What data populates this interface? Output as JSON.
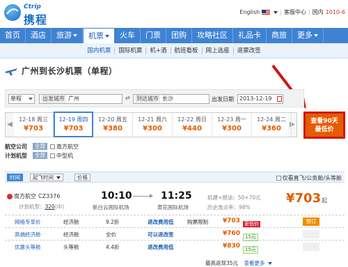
{
  "brand": {
    "logo_en": "Ctrip",
    "logo_cn": "携程"
  },
  "topbar": {
    "language": "English",
    "service": "客服中心",
    "intl": "国内",
    "phone": "1010-6"
  },
  "nav": {
    "items": [
      {
        "label": "首页",
        "active": false,
        "caret": false
      },
      {
        "label": "酒店",
        "active": false,
        "caret": false
      },
      {
        "label": "旅游",
        "active": false,
        "caret": true
      },
      {
        "label": "机票",
        "active": true,
        "caret": true
      },
      {
        "label": "火车",
        "active": false,
        "caret": false
      },
      {
        "label": "门票",
        "active": false,
        "caret": false
      },
      {
        "label": "团购",
        "active": false,
        "caret": false
      },
      {
        "label": "攻略社区",
        "active": false,
        "caret": false
      },
      {
        "label": "礼品卡",
        "active": false,
        "caret": false
      },
      {
        "label": "商旅",
        "active": false,
        "caret": false
      },
      {
        "label": "更多",
        "active": false,
        "caret": true
      }
    ]
  },
  "subnav": {
    "items": [
      {
        "label": "国内机票",
        "active": true
      },
      {
        "label": "国际机票",
        "active": false
      },
      {
        "label": "机+酒",
        "active": false
      },
      {
        "label": "航班看板",
        "active": false
      },
      {
        "label": "网上选座",
        "active": false
      },
      {
        "label": "退票改签",
        "active": false
      }
    ]
  },
  "title": "广州到长沙机票（单程）",
  "search": {
    "trip_type": "单程",
    "from_label": "出发城市",
    "from_value": "广州",
    "to_label": "到达城市",
    "to_value": "长沙",
    "date_label": "出发日期",
    "date_value": "2013-12-19"
  },
  "dates": [
    {
      "date": "12-18 周三",
      "price": "¥703",
      "active": false
    },
    {
      "date": "12-19 周四",
      "price": "¥703",
      "active": true
    },
    {
      "date": "12-20 周五",
      "price": "¥380",
      "active": false
    },
    {
      "date": "12-21 周六",
      "price": "¥300",
      "active": false
    },
    {
      "date": "12-22 周日",
      "price": "¥440",
      "active": false
    },
    {
      "date": "12-23 周一",
      "price": "¥300",
      "active": false
    },
    {
      "date": "12-24 周二",
      "price": "¥360",
      "active": false
    }
  ],
  "lowest_button": {
    "line1": "查看90天",
    "line2": "最低价"
  },
  "filters": {
    "airline_label": "航空公司",
    "airline_all": "全部",
    "airline_option": "南方航空",
    "model_label": "计划机型",
    "model_all": "全部",
    "model_option": "中型机"
  },
  "sortbar": {
    "time": "时间",
    "departure": "起飞时间",
    "price": "价格",
    "direct_only": "仅看直飞/公务舱/头等舱"
  },
  "flight": {
    "airline": "南方航空",
    "code": "CZ3376",
    "plan_prefix": "计划机型：",
    "plan_model": "320",
    "plan_size": "(中)",
    "dep_time": "10:10",
    "arr_time": "11:25",
    "dep_airport": "新白云国际机场",
    "arr_airport": "黄花国际机场",
    "tax": "机建+燃油：50+70元",
    "ontime": "历史准点率：98%",
    "price": "¥703",
    "price_suffix": "起"
  },
  "fares": [
    {
      "name": "网络专享价",
      "cabin": "经济舱",
      "discount": "9.2折",
      "rule": "退改费用低",
      "extra": "购票限制",
      "price": "¥703",
      "tag": "更低价",
      "tag_style": "red",
      "book": "预订"
    },
    {
      "name": "高端经济舱",
      "cabin": "经济舱",
      "discount": "全价",
      "rule": "可以退改签",
      "extra": "",
      "price": "¥760",
      "tag": "15元",
      "tag_style": "green",
      "book": ""
    },
    {
      "name": "优惠头等舱",
      "cabin": "头等舱",
      "discount": "4.4折",
      "rule": "退改费用低",
      "extra": "",
      "price": "¥830",
      "tag": "15元",
      "tag_style": "green",
      "book": ""
    }
  ],
  "bottom": {
    "lowest_return": "最高返现35元",
    "more": "查看更多"
  }
}
